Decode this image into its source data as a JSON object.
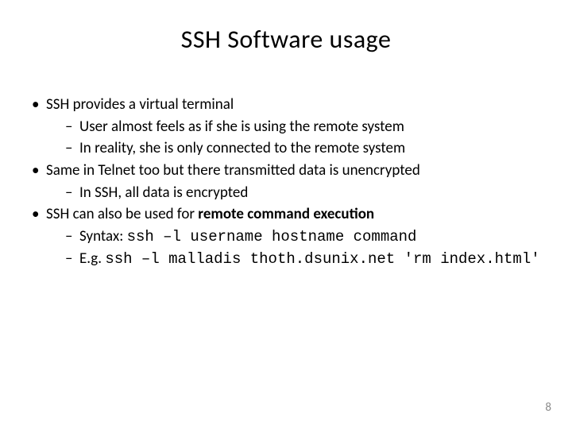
{
  "title": "SSH Software usage",
  "b1": "SSH provides a virtual terminal",
  "b1a": "User almost feels as if she is  using the remote system",
  "b1b": "In reality, she is only connected to the remote system",
  "b2": "Same in Telnet too but there transmitted data is unencrypted",
  "b2a": "In SSH, all data is encrypted",
  "b3_pre": "SSH can also be used for ",
  "b3_bold": "remote command execution",
  "b3a_pre": "Syntax: ",
  "b3a_code": "ssh –l username hostname command",
  "b3b_pre": "E.g. ",
  "b3b_code": "ssh –l malladis thoth.dsunix.net 'rm index.html'",
  "page_number": "8"
}
